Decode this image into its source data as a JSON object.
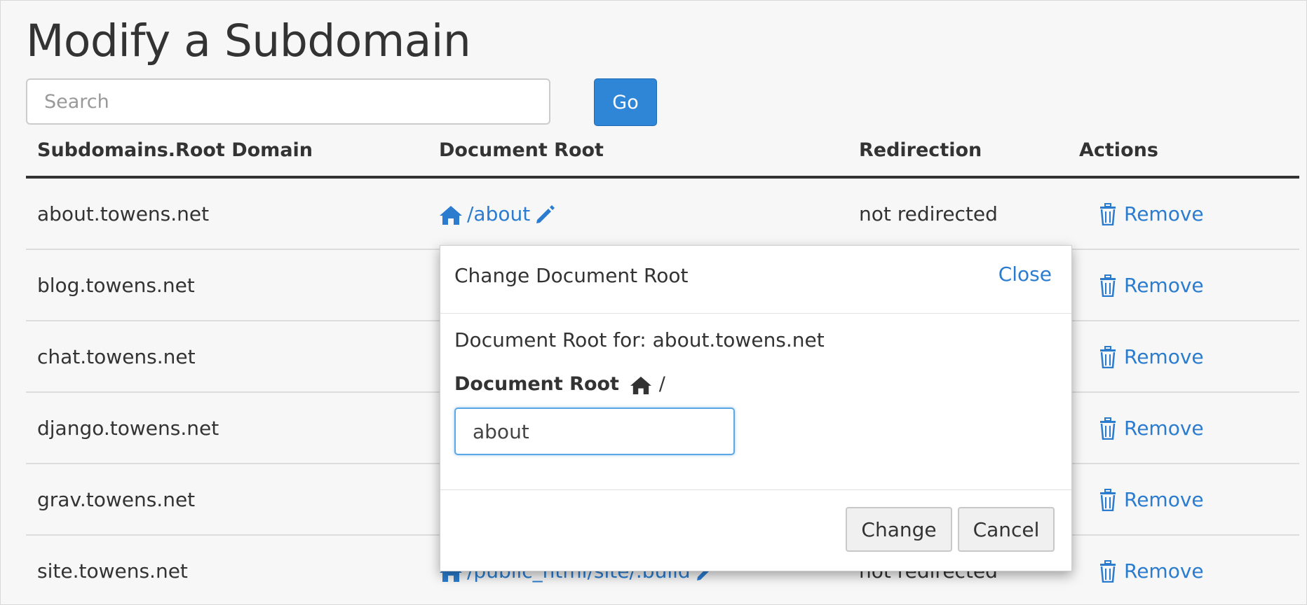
{
  "page": {
    "title": "Modify a Subdomain"
  },
  "search": {
    "placeholder": "Search",
    "go_label": "Go"
  },
  "table": {
    "headers": [
      "Subdomains.Root Domain",
      "Document Root",
      "Redirection",
      "Actions"
    ],
    "rows": [
      {
        "subdomain": "about.towens.net",
        "docroot": "/about",
        "redirection": "not redirected",
        "action": "Remove"
      },
      {
        "subdomain": "blog.towens.net",
        "docroot": "",
        "redirection": "",
        "action": "Remove"
      },
      {
        "subdomain": "chat.towens.net",
        "docroot": "",
        "redirection": "",
        "action": "Remove"
      },
      {
        "subdomain": "django.towens.net",
        "docroot": "",
        "redirection": "",
        "action": "Remove"
      },
      {
        "subdomain": "grav.towens.net",
        "docroot": "",
        "redirection": "",
        "action": "Remove"
      },
      {
        "subdomain": "site.towens.net",
        "docroot": "/public_html/site/.build",
        "redirection": "not redirected",
        "action": "Remove"
      }
    ]
  },
  "modal": {
    "title": "Change Document Root",
    "close_label": "Close",
    "description": "Document Root for: about.towens.net",
    "field_label": "Document Root",
    "field_suffix": "/",
    "field_value": "about",
    "change_label": "Change",
    "cancel_label": "Cancel"
  },
  "colors": {
    "link": "#2b7ccf",
    "primary_button": "#2f86d6",
    "text": "#333333"
  },
  "icons": {
    "home": "home-icon",
    "edit": "pencil-icon",
    "remove": "trash-icon"
  }
}
